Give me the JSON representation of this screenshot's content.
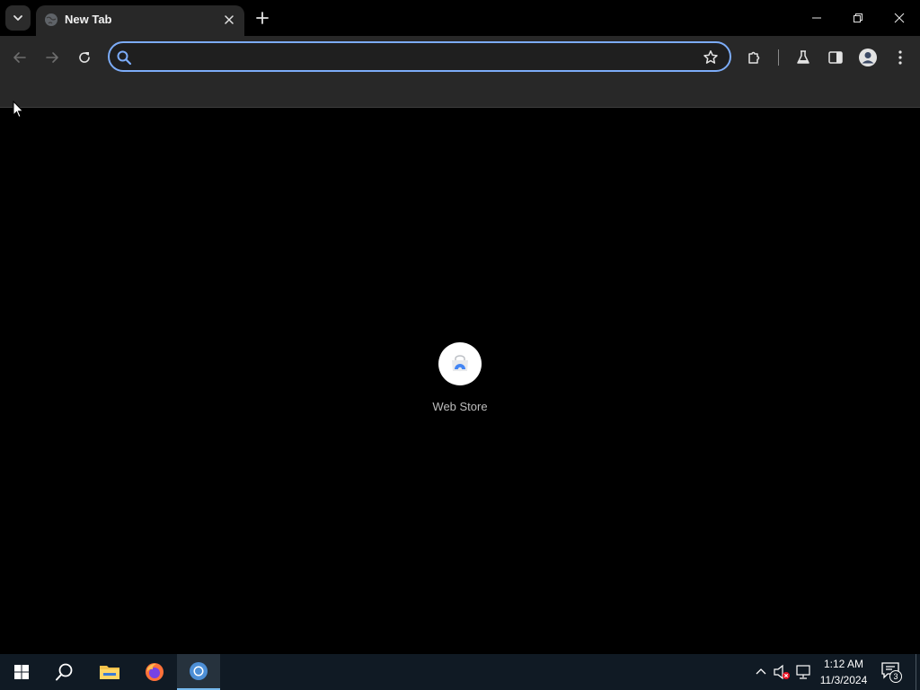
{
  "browser": {
    "tab": {
      "title": "New Tab",
      "favicon": "globe-icon"
    },
    "omnibox": {
      "value": "",
      "placeholder": ""
    },
    "accent_color": "#7cacf8"
  },
  "page": {
    "shortcuts": [
      {
        "label": "Web Store",
        "icon": "chrome-web-store-icon"
      }
    ]
  },
  "taskbar": {
    "apps": [
      {
        "name": "start",
        "icon": "windows-logo-icon"
      },
      {
        "name": "search",
        "icon": "search-icon"
      },
      {
        "name": "file-explorer",
        "icon": "folder-icon"
      },
      {
        "name": "firefox",
        "icon": "firefox-icon"
      },
      {
        "name": "chrome",
        "icon": "chrome-icon",
        "active": true
      }
    ],
    "clock": {
      "time": "1:12 AM",
      "date": "11/3/2024"
    },
    "notification_count": "3"
  }
}
